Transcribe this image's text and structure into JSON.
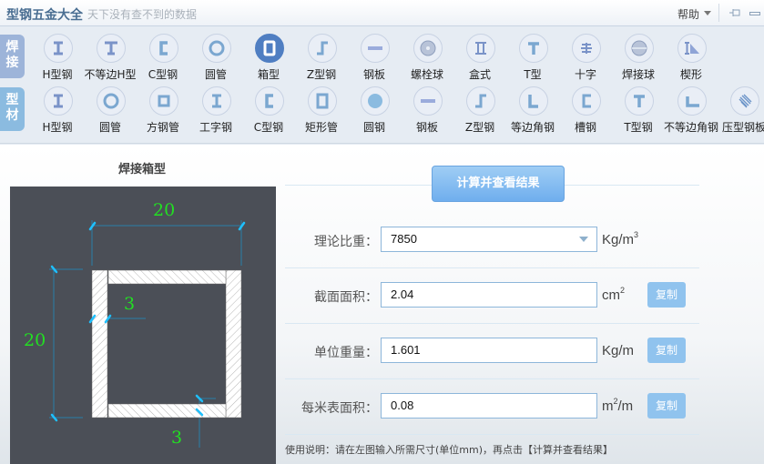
{
  "titlebar": {
    "app_title": "型钢五金大全",
    "slogan": "天下没有查不到的数据",
    "help_label": "帮助"
  },
  "toolbar": {
    "weld": {
      "category_label": "焊接",
      "items": [
        {
          "label": "H型钢",
          "icon": "h-beam-icon"
        },
        {
          "label": "不等边H型",
          "icon": "unequal-h-beam-icon"
        },
        {
          "label": "C型钢",
          "icon": "c-channel-icon"
        },
        {
          "label": "圆管",
          "icon": "round-tube-icon"
        },
        {
          "label": "箱型",
          "icon": "box-section-icon",
          "active": true
        },
        {
          "label": "Z型钢",
          "icon": "z-section-icon"
        },
        {
          "label": "钢板",
          "icon": "steel-plate-icon"
        },
        {
          "label": "螺栓球",
          "icon": "bolt-ball-icon"
        },
        {
          "label": "盒式",
          "icon": "box-type-icon"
        },
        {
          "label": "T型",
          "icon": "t-section-icon"
        },
        {
          "label": "十字",
          "icon": "cross-section-icon"
        },
        {
          "label": "焊接球",
          "icon": "weld-ball-icon"
        },
        {
          "label": "楔形",
          "icon": "wedge-icon"
        }
      ]
    },
    "steel": {
      "category_label": "型材",
      "items": [
        {
          "label": "H型钢",
          "icon": "h-beam-icon"
        },
        {
          "label": "圆管",
          "icon": "round-tube-icon"
        },
        {
          "label": "方钢管",
          "icon": "square-tube-icon"
        },
        {
          "label": "工字钢",
          "icon": "i-beam-icon"
        },
        {
          "label": "C型钢",
          "icon": "c-channel-icon"
        },
        {
          "label": "矩形管",
          "icon": "rect-tube-icon"
        },
        {
          "label": "圆钢",
          "icon": "round-bar-icon"
        },
        {
          "label": "钢板",
          "icon": "steel-plate-icon"
        },
        {
          "label": "Z型钢",
          "icon": "z-section-icon"
        },
        {
          "label": "等边角钢",
          "icon": "equal-angle-icon"
        },
        {
          "label": "槽钢",
          "icon": "channel-icon"
        },
        {
          "label": "T型钢",
          "icon": "t-section-icon"
        },
        {
          "label": "不等边角钢",
          "icon": "unequal-angle-icon"
        },
        {
          "label": "压型钢板",
          "icon": "profiled-sheet-icon"
        }
      ]
    }
  },
  "drawing": {
    "title": "焊接箱型",
    "width": "20",
    "height": "20",
    "web_thickness": "3",
    "flange_thickness": "3"
  },
  "form": {
    "calc_button": "计算并查看结果",
    "density": {
      "label": "理论比重：",
      "value": "7850",
      "unit_base": "Kg/m",
      "unit_sup": "3"
    },
    "area": {
      "label": "截面面积：",
      "value": "2.04",
      "unit_base": "cm",
      "unit_sup": "2",
      "copy": "复制"
    },
    "weight": {
      "label": "单位重量：",
      "value": "1.601",
      "unit_base": "Kg/m",
      "copy": "复制"
    },
    "surface": {
      "label": "每米表面积：",
      "value": "0.08",
      "unit_base": "m",
      "unit_sup": "2",
      "unit_tail": "/m",
      "copy": "复制"
    },
    "usage": "使用说明：请在左图输入所需尺寸(单位mm)，再点击【计算并查看结果】"
  }
}
